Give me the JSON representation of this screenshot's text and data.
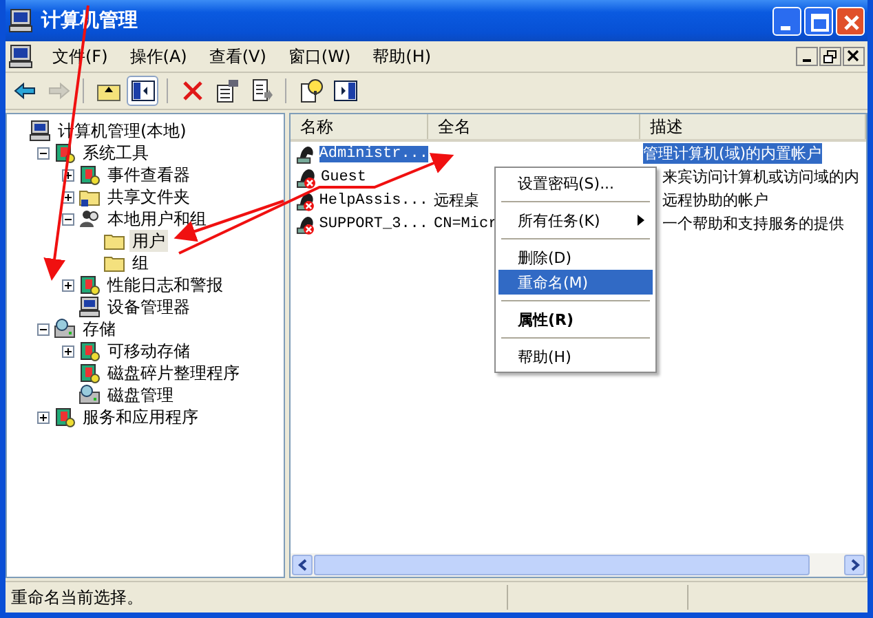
{
  "window": {
    "title": "计算机管理"
  },
  "menu_bar": [
    {
      "label": "文件(F)"
    },
    {
      "label": "操作(A)"
    },
    {
      "label": "查看(V)"
    },
    {
      "label": "窗口(W)"
    },
    {
      "label": "帮助(H)"
    }
  ],
  "toolbar": [
    {
      "kind": "back",
      "disabled": false,
      "pressed": false
    },
    {
      "kind": "forward",
      "disabled": true,
      "pressed": false
    },
    {
      "kind": "sep"
    },
    {
      "kind": "up",
      "disabled": false,
      "pressed": false
    },
    {
      "kind": "tree",
      "disabled": false,
      "pressed": true
    },
    {
      "kind": "sep"
    },
    {
      "kind": "delete",
      "disabled": false,
      "pressed": false
    },
    {
      "kind": "properties",
      "disabled": false,
      "pressed": false
    },
    {
      "kind": "export",
      "disabled": false,
      "pressed": false
    },
    {
      "kind": "sep"
    },
    {
      "kind": "help",
      "disabled": false,
      "pressed": false
    },
    {
      "kind": "pane",
      "disabled": false,
      "pressed": false
    }
  ],
  "tree": [
    {
      "label": "计算机管理(本地)",
      "kind": "computer",
      "selected": false,
      "children": [
        {
          "label": "系统工具",
          "kind": "tools",
          "expanded": true,
          "selected": false,
          "children": [
            {
              "label": "事件查看器",
              "kind": "snapin",
              "expanded": false,
              "selected": false
            },
            {
              "label": "共享文件夹",
              "kind": "share",
              "expanded": false,
              "selected": false
            },
            {
              "label": "本地用户和组",
              "kind": "users",
              "expanded": true,
              "selected": false,
              "children": [
                {
                  "label": "用户",
                  "kind": "folder",
                  "selected": true
                },
                {
                  "label": "组",
                  "kind": "folder",
                  "selected": false
                }
              ]
            },
            {
              "label": "性能日志和警报",
              "kind": "snapin",
              "expanded": false,
              "selected": false
            },
            {
              "label": "设备管理器",
              "kind": "computer",
              "selected": false
            }
          ]
        },
        {
          "label": "存储",
          "kind": "drive",
          "expanded": true,
          "selected": false,
          "children": [
            {
              "label": "可移动存储",
              "kind": "snapin",
              "expanded": false,
              "selected": false
            },
            {
              "label": "磁盘碎片整理程序",
              "kind": "snapin",
              "selected": false
            },
            {
              "label": "磁盘管理",
              "kind": "drive",
              "selected": false
            }
          ]
        },
        {
          "label": "服务和应用程序",
          "kind": "tools",
          "expanded": false,
          "selected": false
        }
      ]
    }
  ],
  "table": {
    "columns": [
      "名称",
      "全名",
      "描述"
    ],
    "rows": [
      {
        "name": "Administr...",
        "full_name": "",
        "description": "管理计算机(域)的内置帐户",
        "disabled": false,
        "selected": true
      },
      {
        "name": "Guest",
        "full_name": "",
        "description": "来宾访问计算机或访问域的内",
        "disabled": true,
        "selected": false
      },
      {
        "name": "HelpAssis...",
        "full_name": "远程桌",
        "description": "远程协助的帐户",
        "disabled": true,
        "selected": false
      },
      {
        "name": "SUPPORT_3...",
        "full_name": "CN=Micr",
        "description": "一个帮助和支持服务的提供",
        "disabled": true,
        "selected": false
      }
    ]
  },
  "context_menu": [
    {
      "kind": "item",
      "label": "设置密码(S)...",
      "selected": false
    },
    {
      "kind": "sep"
    },
    {
      "kind": "submenu",
      "label": "所有任务(K)",
      "selected": false
    },
    {
      "kind": "sep"
    },
    {
      "kind": "item",
      "label": "删除(D)",
      "selected": false
    },
    {
      "kind": "item",
      "label": "重命名(M)",
      "selected": true
    },
    {
      "kind": "sep"
    },
    {
      "kind": "default",
      "label": "属性(R)",
      "selected": false
    },
    {
      "kind": "sep"
    },
    {
      "kind": "item",
      "label": "帮助(H)",
      "selected": false
    }
  ],
  "status_bar": "重命名当前选择。"
}
